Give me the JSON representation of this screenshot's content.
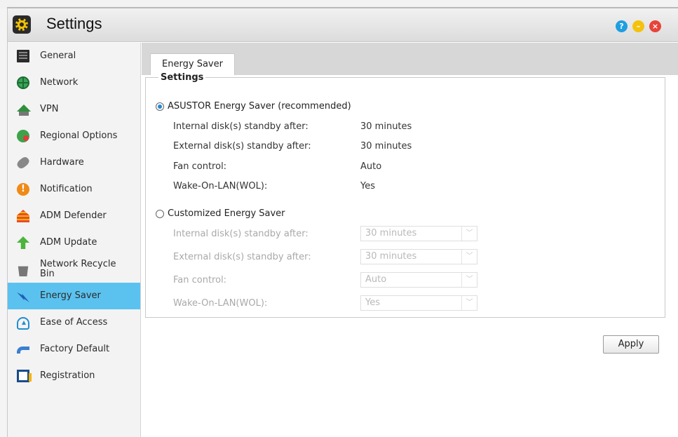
{
  "window": {
    "title": "Settings"
  },
  "sidebar": {
    "items": [
      {
        "label": "General",
        "icon": "general-icon",
        "active": false
      },
      {
        "label": "Network",
        "icon": "globe-icon",
        "active": false
      },
      {
        "label": "VPN",
        "icon": "vpn-icon",
        "active": false
      },
      {
        "label": "Regional Options",
        "icon": "regional-icon",
        "active": false
      },
      {
        "label": "Hardware",
        "icon": "hardware-icon",
        "active": false
      },
      {
        "label": "Notification",
        "icon": "notification-icon",
        "active": false
      },
      {
        "label": "ADM Defender",
        "icon": "firewall-icon",
        "active": false
      },
      {
        "label": "ADM Update",
        "icon": "update-arrow-icon",
        "active": false
      },
      {
        "label": "Network Recycle Bin",
        "icon": "recycle-bin-icon",
        "active": false
      },
      {
        "label": "Energy Saver",
        "icon": "energy-icon",
        "active": true
      },
      {
        "label": "Ease of Access",
        "icon": "cloud-upload-icon",
        "active": false
      },
      {
        "label": "Factory Default",
        "icon": "undo-arrow-icon",
        "active": false
      },
      {
        "label": "Registration",
        "icon": "registration-icon",
        "active": false
      }
    ]
  },
  "tabs": [
    {
      "label": "Energy Saver",
      "active": true
    }
  ],
  "settings": {
    "legend": "Settings",
    "asustor": {
      "label": "ASUSTOR Energy Saver (recommended)",
      "selected": true,
      "rows": [
        {
          "label": "Internal disk(s) standby after:",
          "value": "30 minutes"
        },
        {
          "label": "External disk(s) standby after:",
          "value": "30 minutes"
        },
        {
          "label": "Fan control:",
          "value": "Auto"
        },
        {
          "label": "Wake-On-LAN(WOL):",
          "value": "Yes"
        }
      ]
    },
    "custom": {
      "label": "Customized Energy Saver",
      "selected": false,
      "rows": [
        {
          "label": "Internal disk(s) standby after:",
          "value": "30 minutes"
        },
        {
          "label": "External disk(s) standby after:",
          "value": "30 minutes"
        },
        {
          "label": "Fan control:",
          "value": "Auto"
        },
        {
          "label": "Wake-On-LAN(WOL):",
          "value": "Yes"
        }
      ]
    }
  },
  "actions": {
    "apply_label": "Apply"
  },
  "colors": {
    "active_sidebar": "#5bc2ef",
    "help": "#1f9ee0",
    "minimize": "#f4c20d",
    "close": "#e8423a"
  }
}
